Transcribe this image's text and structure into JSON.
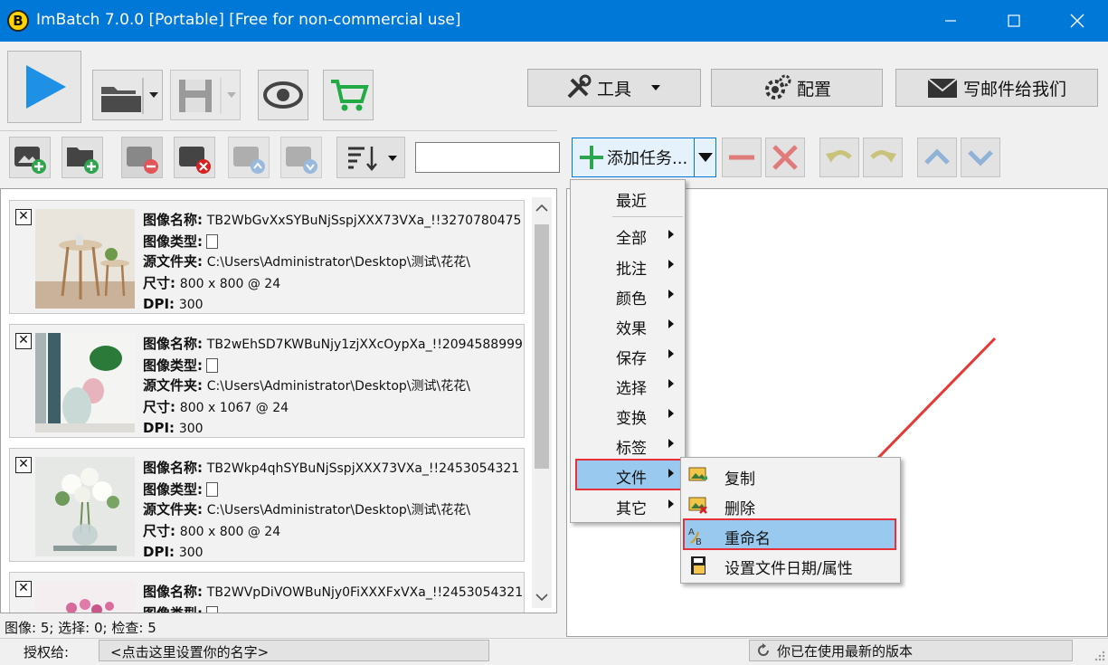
{
  "window": {
    "app_icon_letter": "B",
    "title": "ImBatch 7.0.0 [Portable] [Free for non-commercial use]"
  },
  "toolbar": {
    "tools_label": "工具",
    "config_label": "配置",
    "email_label": "写邮件给我们"
  },
  "task_toolbar": {
    "add_task_label": "添加任务..."
  },
  "images": [
    {
      "name_label": "图像名称:",
      "name": "TB2WbGvXxSYBuNjSspjXXX73VXa_!!3270780475",
      "type_label": "图像类型:",
      "folder_label": "源文件夹:",
      "folder": "C:\\Users\\Administrator\\Desktop\\测试\\花花\\",
      "size_label": "尺寸:",
      "size": "800 x 800 @ 24",
      "dpi_label": "DPI:",
      "dpi": "300"
    },
    {
      "name_label": "图像名称:",
      "name": "TB2wEhSD7KWBuNjy1zjXXcOypXa_!!2094588999",
      "type_label": "图像类型:",
      "folder_label": "源文件夹:",
      "folder": "C:\\Users\\Administrator\\Desktop\\测试\\花花\\",
      "size_label": "尺寸:",
      "size": "800 x 1067 @ 24",
      "dpi_label": "DPI:",
      "dpi": "300"
    },
    {
      "name_label": "图像名称:",
      "name": "TB2Wkp4qhSYBuNjSspjXXX73VXa_!!2453054321",
      "type_label": "图像类型:",
      "folder_label": "源文件夹:",
      "folder": "C:\\Users\\Administrator\\Desktop\\测试\\花花\\",
      "size_label": "尺寸:",
      "size": "800 x 800 @ 24",
      "dpi_label": "DPI:",
      "dpi": "300"
    },
    {
      "name_label": "图像名称:",
      "name": "TB2WVpDiVOWBuNjy0FiXXXFxVXa_!!2453054321",
      "type_label": "图像类型:"
    }
  ],
  "task_menu": {
    "recent": "最近",
    "items": [
      "全部",
      "批注",
      "颜色",
      "效果",
      "保存",
      "选择",
      "变换",
      "标签",
      "文件",
      "其它"
    ],
    "highlighted": "文件"
  },
  "file_submenu": {
    "items": [
      "复制",
      "删除",
      "重命名",
      "设置文件日期/属性"
    ],
    "highlighted": "重命名"
  },
  "status": {
    "left": "图像: 5; 选择: 0; 检查: 5",
    "license_label": "授权给:",
    "license_value": "<点击这里设置你的名字>",
    "version": "你已在使用最新的版本"
  },
  "colors": {
    "titlebar": "#0078d7",
    "highlight": "#99c9ef",
    "red_box": "#e8303a",
    "annotation_arrow": "#e53935"
  }
}
